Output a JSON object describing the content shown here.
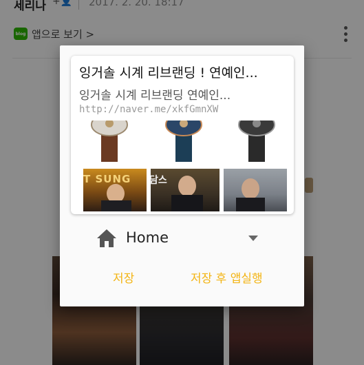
{
  "background": {
    "author": "세리나",
    "follow_label": "+👤",
    "date": "2017. 2. 20. 18:17",
    "app_badge": "blog",
    "app_link": "앱으로 보기 >"
  },
  "dialog": {
    "preview": {
      "title": "잉거솔 시계 리브랜딩 ! 연예인...",
      "description": "잉거솔 시계 리브랜딩 연예인...",
      "url": "http://naver.me/xkfGmnXW",
      "thumb_caption_1": "T SUNG",
      "thumb_caption_2": "담스"
    },
    "category": {
      "icon": "home-icon",
      "selected": "Home"
    },
    "buttons": {
      "save": "저장",
      "save_and_launch": "저장 후 앱실행"
    }
  },
  "colors": {
    "accent": "#f3b413",
    "blog_green": "#2db400",
    "scrim": "rgba(0,0,0,0.43)"
  }
}
